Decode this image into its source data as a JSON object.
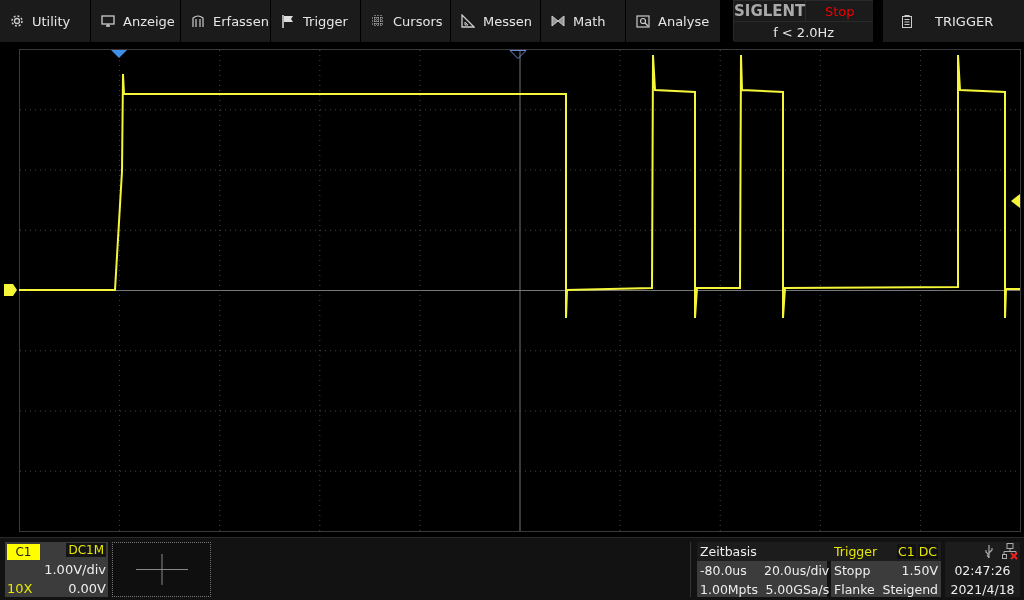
{
  "menu": [
    {
      "label": "Utility"
    },
    {
      "label": "Anzeige"
    },
    {
      "label": "Erfassen"
    },
    {
      "label": "Trigger"
    },
    {
      "label": "Cursors"
    },
    {
      "label": "Messen"
    },
    {
      "label": "Math"
    },
    {
      "label": "Analyse"
    }
  ],
  "status": {
    "brand": "SIGLENT",
    "run_state": "Stop",
    "frequency": "f < 2.0Hz"
  },
  "panel_button": {
    "label": "TRIGGER"
  },
  "channel": {
    "name": "C1",
    "coupling": "DC1M",
    "scale": "1.00V/div",
    "probe": "10X",
    "offset": "0.00V"
  },
  "timebase": {
    "title": "Zeitbasis",
    "delay": "-80.0us",
    "scale": "20.0us/div",
    "memory": "1.00Mpts",
    "sample_rate": "5.00GSa/s"
  },
  "trigger": {
    "title": "Trigger",
    "source": "C1",
    "coupling": "DC",
    "mode": "Stopp",
    "level": "1.50V",
    "type": "Flanke",
    "slope": "Steigend"
  },
  "clock": {
    "time": "02:47:26",
    "date": "2021/4/18"
  }
}
